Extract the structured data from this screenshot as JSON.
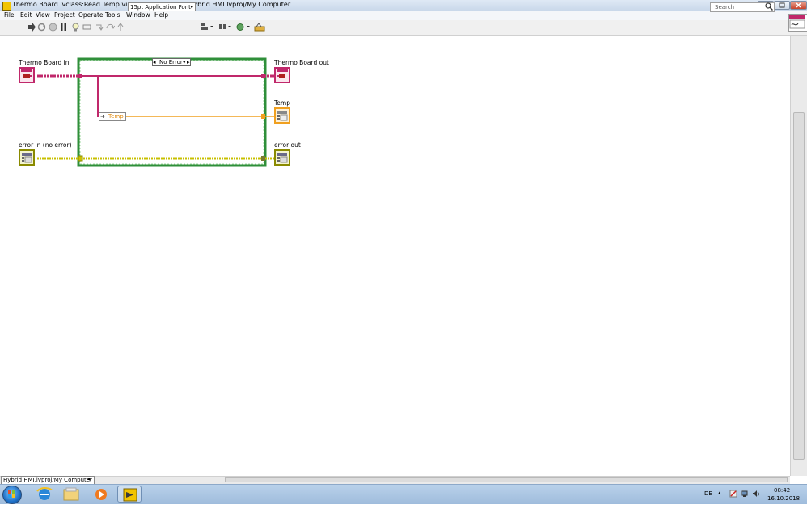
{
  "window": {
    "title": "Thermo Board.lvclass:Read Temp.vi Block Diagram on Hybrid HMI.lvproj/My Computer",
    "controls": [
      "minimize",
      "maximize",
      "close"
    ]
  },
  "menu": {
    "items": [
      "File",
      "Edit",
      "View",
      "Project",
      "Operate",
      "Tools",
      "Window",
      "Help"
    ]
  },
  "toolbar": {
    "font": "15pt Application Font",
    "search_placeholder": "Search",
    "icons": [
      "run-arrow-icon",
      "run-continuously-icon",
      "abort-icon",
      "pause-icon",
      "highlight-execution-icon",
      "retain-wire-values-icon",
      "step-into-icon",
      "step-over-icon",
      "step-out-icon",
      "align-objects-icon",
      "distribute-objects-icon",
      "reorder-icon",
      "clean-up-diagram-icon"
    ]
  },
  "diagram": {
    "terminals": {
      "thermo_board_in": "Thermo Board in",
      "thermo_board_out": "Thermo Board out",
      "temp": "Temp",
      "error_in": "error in (no error)",
      "error_out": "error out"
    },
    "case_selector": "No Error",
    "unbundle_element": "Temp",
    "wire_colors": {
      "class": "#c0286b",
      "numeric": "#f0a020",
      "error_cluster": "#c8c000",
      "case_border": "#2f8f3a"
    }
  },
  "status": {
    "context": "Hybrid HMI.lvproj/My Computer"
  },
  "taskbar": {
    "apps": [
      "internet-explorer-icon",
      "file-explorer-icon",
      "media-player-icon",
      "labview-icon"
    ],
    "language": "DE",
    "time": "08:42",
    "date": "16.10.2018"
  }
}
